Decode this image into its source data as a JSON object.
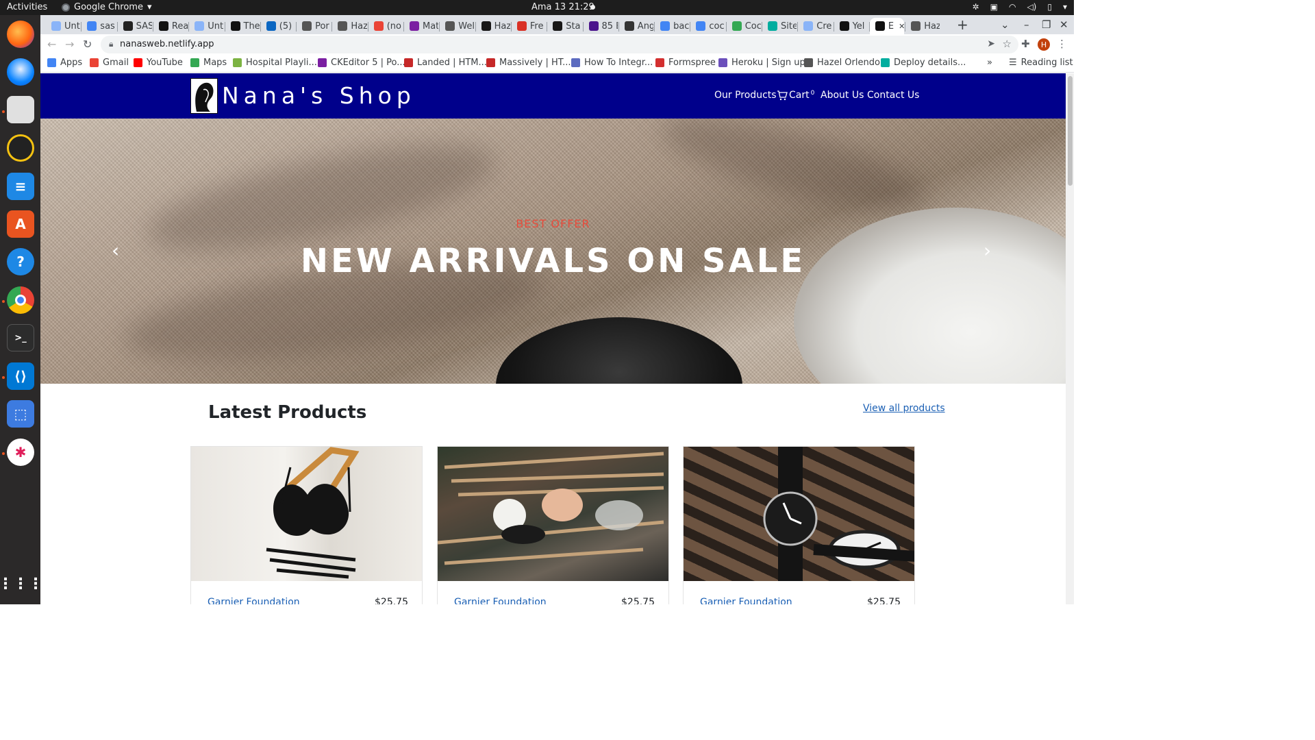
{
  "system": {
    "activities": "Activities",
    "app_name": "Google Chrome",
    "clock": "Ama 13  21:29"
  },
  "dock": {
    "apps": [
      "firefox-icon",
      "thunderbird-icon",
      "files-icon",
      "rhythmbox-icon",
      "writer-icon",
      "app-center-icon",
      "help-icon",
      "chrome-icon",
      "terminal-icon",
      "vscode-icon",
      "screenshot-icon",
      "slack-icon",
      "show-apps-icon"
    ]
  },
  "browser": {
    "tabs": [
      {
        "label": "Unt",
        "color": "#8ab4f8"
      },
      {
        "label": "sas",
        "color": "#4285f4"
      },
      {
        "label": "SAS",
        "color": "#222222"
      },
      {
        "label": "Rea",
        "color": "#111111"
      },
      {
        "label": "Unt",
        "color": "#8ab4f8"
      },
      {
        "label": "The",
        "color": "#111111"
      },
      {
        "label": "(5) I",
        "color": "#0a66c2"
      },
      {
        "label": "Por",
        "color": "#555555"
      },
      {
        "label": "Haz",
        "color": "#555555"
      },
      {
        "label": "(no",
        "color": "#ea4335"
      },
      {
        "label": "Mat",
        "color": "#7b1fa2"
      },
      {
        "label": "Wel",
        "color": "#555555"
      },
      {
        "label": "Haz",
        "color": "#181717"
      },
      {
        "label": "Fre",
        "color": "#d93025"
      },
      {
        "label": "Sta",
        "color": "#181717"
      },
      {
        "label": "85 E",
        "color": "#4a148c"
      },
      {
        "label": "Ang",
        "color": "#333333"
      },
      {
        "label": "bac",
        "color": "#4285f4"
      },
      {
        "label": "coc",
        "color": "#4285f4"
      },
      {
        "label": "Coc",
        "color": "#34a853"
      },
      {
        "label": "Site",
        "color": "#00ad9f"
      },
      {
        "label": "Cre",
        "color": "#8ab4f8"
      },
      {
        "label": "Yel",
        "color": "#111111"
      },
      {
        "label": "E",
        "color": "#111111"
      },
      {
        "label": "Haz",
        "color": "#555555"
      }
    ],
    "url": "nanasweb.netlify.app",
    "bookmarks": [
      {
        "label": "Apps",
        "color": "#4285f4"
      },
      {
        "label": "Gmail",
        "color": "#ea4335"
      },
      {
        "label": "YouTube",
        "color": "#ff0000"
      },
      {
        "label": "Maps",
        "color": "#34a853"
      },
      {
        "label": "Hospital Playli...",
        "color": "#7cb342"
      },
      {
        "label": "CKEditor 5 | Po...",
        "color": "#7b1fa2"
      },
      {
        "label": "Landed | HTM...",
        "color": "#c62828"
      },
      {
        "label": "Massively | HT...",
        "color": "#c62828"
      },
      {
        "label": "How To Integr...",
        "color": "#5c6bc0"
      },
      {
        "label": "Formspree",
        "color": "#d32f2f"
      },
      {
        "label": "Heroku | Sign up",
        "color": "#6b4fbb"
      },
      {
        "label": "Hazel Orlendo",
        "color": "#555555"
      },
      {
        "label": "Deploy details...",
        "color": "#00ad9f"
      }
    ],
    "reading_list": "Reading list",
    "profile_initial": "H"
  },
  "site": {
    "brand": "Nana's Shop",
    "nav": {
      "products": "Our Products",
      "cart": "Cart",
      "cart_count": "0",
      "about": "About Us",
      "contact": "Contact Us"
    },
    "hero": {
      "eyebrow": "BEST OFFER",
      "title": "NEW ARRIVALS ON SALE",
      "prev": "‹",
      "next": "›"
    },
    "latest": {
      "title": "Latest Products",
      "view_all": "View all products",
      "products": [
        {
          "name": "Garnier Foundation",
          "price": "$25.75",
          "image": "lingerie-on-hanger"
        },
        {
          "name": "Garnier Foundation",
          "price": "$25.75",
          "image": "makeup-brushes"
        },
        {
          "name": "Garnier Foundation",
          "price": "$25.75",
          "image": "wristwatches"
        }
      ]
    }
  }
}
